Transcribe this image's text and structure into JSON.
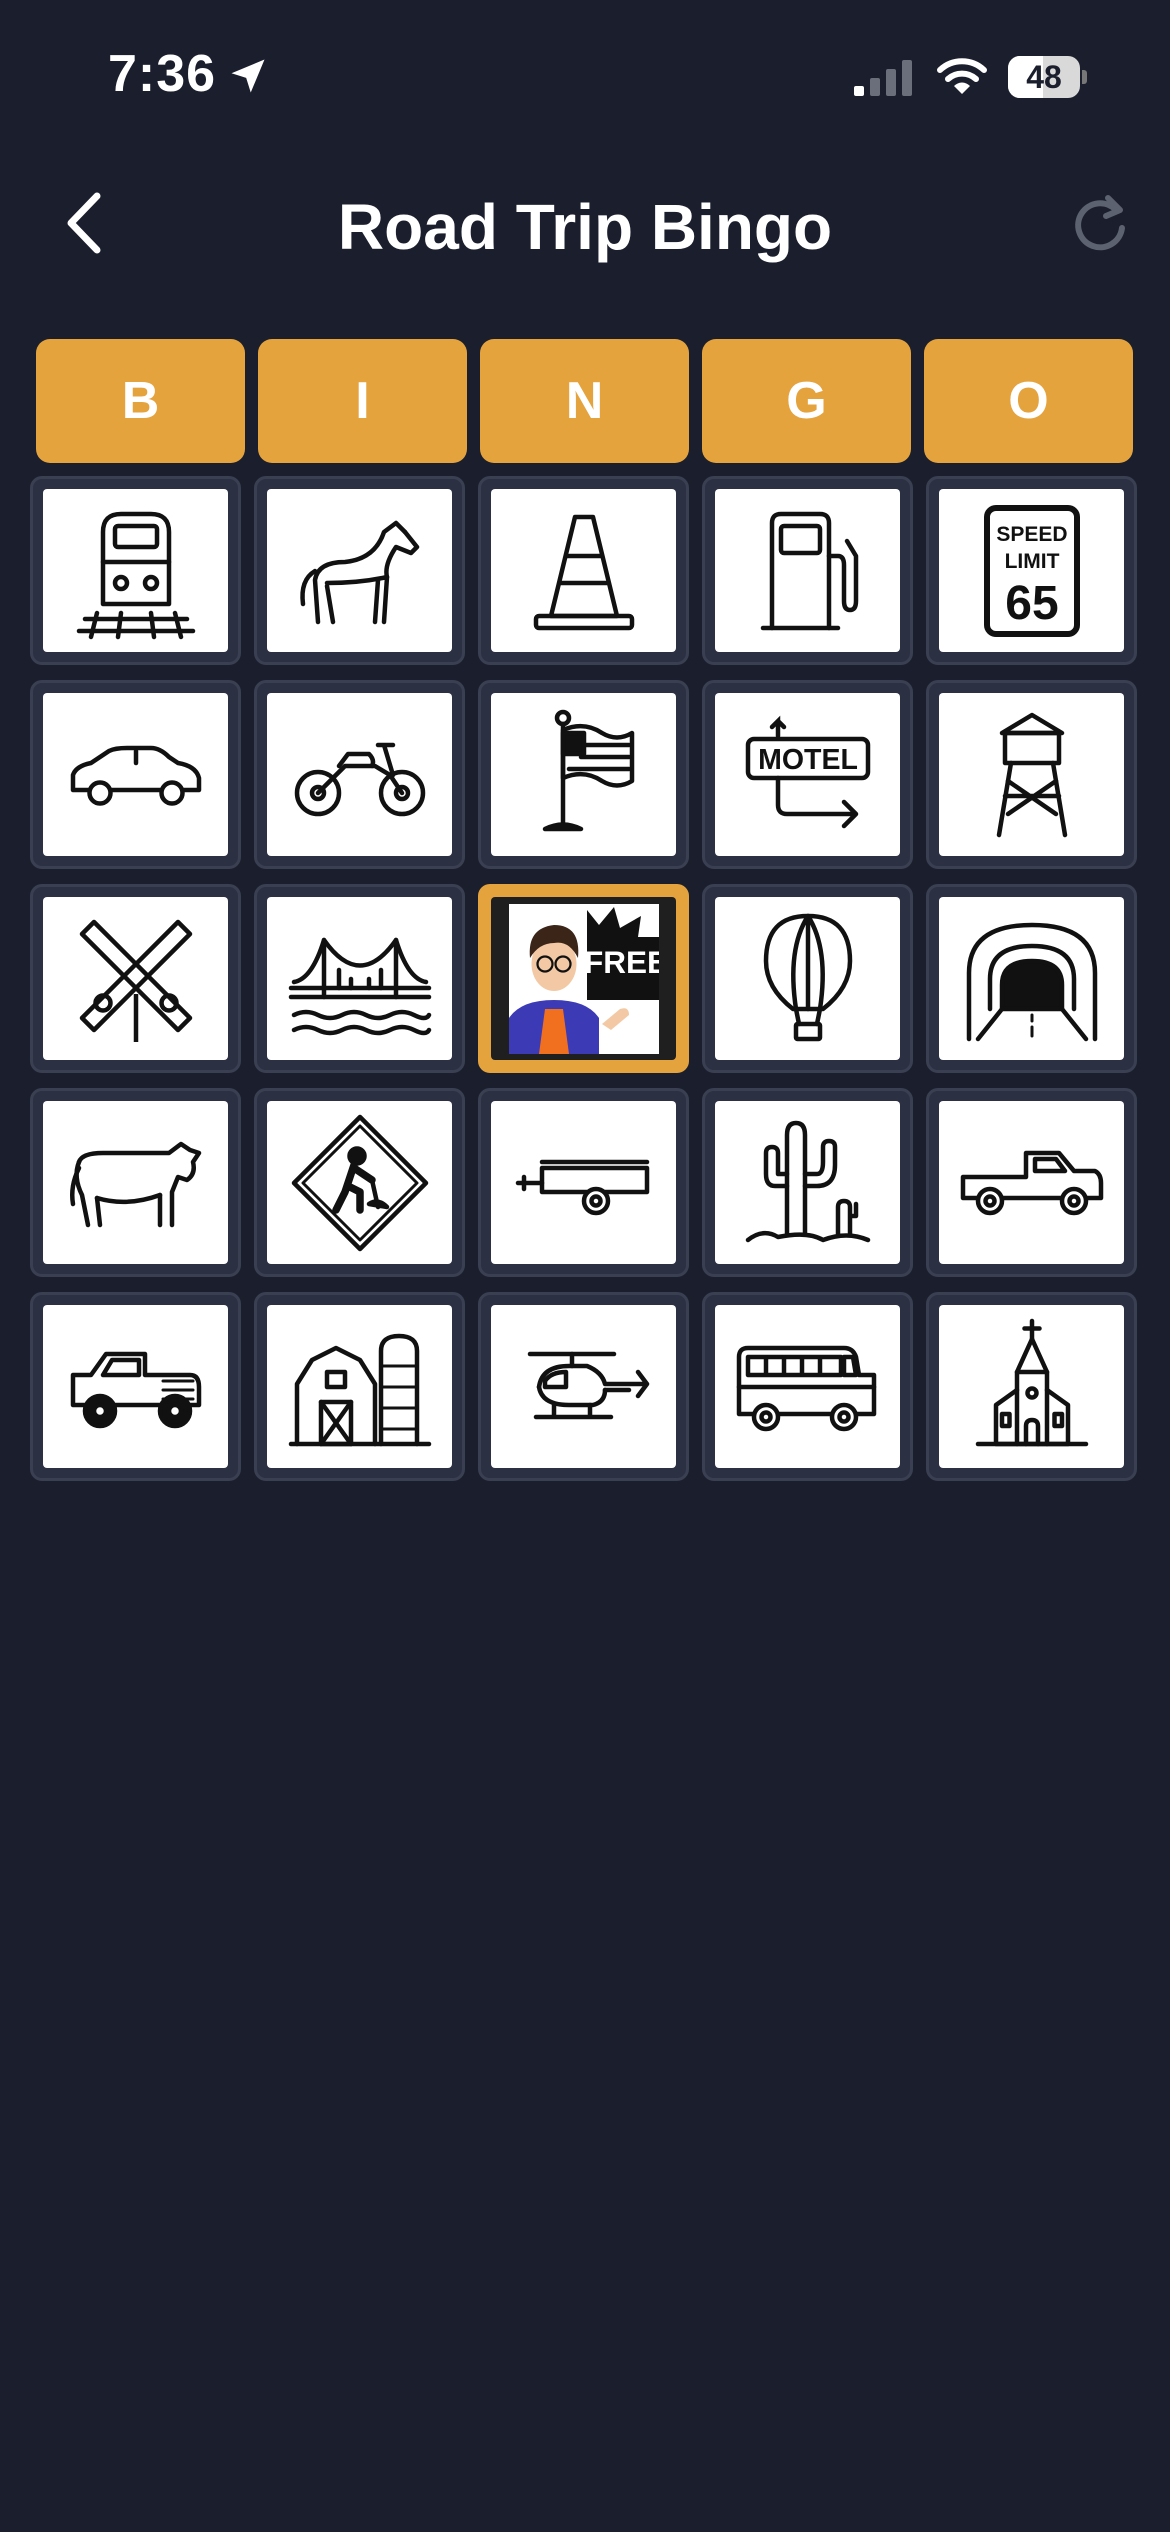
{
  "status": {
    "time": "7:36",
    "battery": "48",
    "battery_level": 0.48
  },
  "nav": {
    "title": "Road Trip Bingo"
  },
  "header": [
    "B",
    "I",
    "N",
    "G",
    "O"
  ],
  "grid": [
    [
      {
        "item": "train"
      },
      {
        "item": "horse"
      },
      {
        "item": "traffic-cone"
      },
      {
        "item": "gas-pump"
      },
      {
        "item": "speed-limit-sign",
        "text1": "SPEED",
        "text2": "LIMIT",
        "text3": "65"
      }
    ],
    [
      {
        "item": "car"
      },
      {
        "item": "motorcycle"
      },
      {
        "item": "flag"
      },
      {
        "item": "motel-sign",
        "text1": "MOTEL"
      },
      {
        "item": "water-tower"
      }
    ],
    [
      {
        "item": "railroad-crossing"
      },
      {
        "item": "bridge"
      },
      {
        "item": "free-space",
        "text1": "FREE"
      },
      {
        "item": "hot-air-balloon"
      },
      {
        "item": "tunnel"
      }
    ],
    [
      {
        "item": "cow"
      },
      {
        "item": "road-work-sign"
      },
      {
        "item": "trailer"
      },
      {
        "item": "cactus"
      },
      {
        "item": "pickup-truck"
      }
    ],
    [
      {
        "item": "jeep"
      },
      {
        "item": "barn"
      },
      {
        "item": "helicopter"
      },
      {
        "item": "school-bus"
      },
      {
        "item": "church"
      }
    ]
  ],
  "colors": {
    "background": "#1b1f2d",
    "accent": "#e4a33d",
    "cell_border": "#3a4052"
  }
}
